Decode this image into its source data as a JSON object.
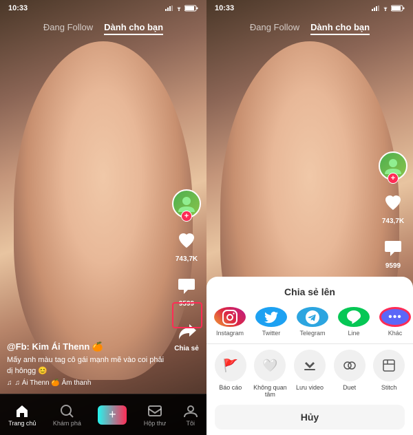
{
  "left_phone": {
    "status_time": "10:33",
    "nav": {
      "following": "Đang Follow",
      "for_you": "Dành cho bạn"
    },
    "actions": {
      "likes": "743,7K",
      "comments": "9599",
      "share": "Chia sẻ"
    },
    "video": {
      "username": "@Fb: Kim Ái Thenn 🍊",
      "description": "Mấy anh màu tag cô gái mạnh mẽ vào coi phải dị hôngg 😊",
      "music": "♫ Ái Thenn 🍊 Âm thanh"
    },
    "bottom_nav": {
      "home": "Trang chủ",
      "explore": "Khám phá",
      "inbox": "Hộp thư",
      "profile": "Tôi"
    }
  },
  "right_phone": {
    "status_time": "10:33",
    "nav": {
      "following": "Đang Follow",
      "for_you": "Dành cho bạn"
    },
    "actions": {
      "likes": "743,7K",
      "comments": "9599"
    },
    "share_sheet": {
      "title": "Chia sẻ lên",
      "apps": [
        {
          "name": "Instagram",
          "type": "instagram"
        },
        {
          "name": "Twitter",
          "type": "twitter"
        },
        {
          "name": "Telegram",
          "type": "telegram"
        },
        {
          "name": "Line",
          "type": "line"
        },
        {
          "name": "Khác",
          "type": "more"
        }
      ],
      "actions": [
        {
          "name": "Báo cáo",
          "icon": "🚩"
        },
        {
          "name": "Không quan tâm",
          "icon": "🤍"
        },
        {
          "name": "Lưu video",
          "icon": "⬇️"
        },
        {
          "name": "Duet",
          "icon": "◎"
        },
        {
          "name": "Stitch",
          "icon": "⊟"
        }
      ],
      "cancel": "Hủy"
    }
  }
}
